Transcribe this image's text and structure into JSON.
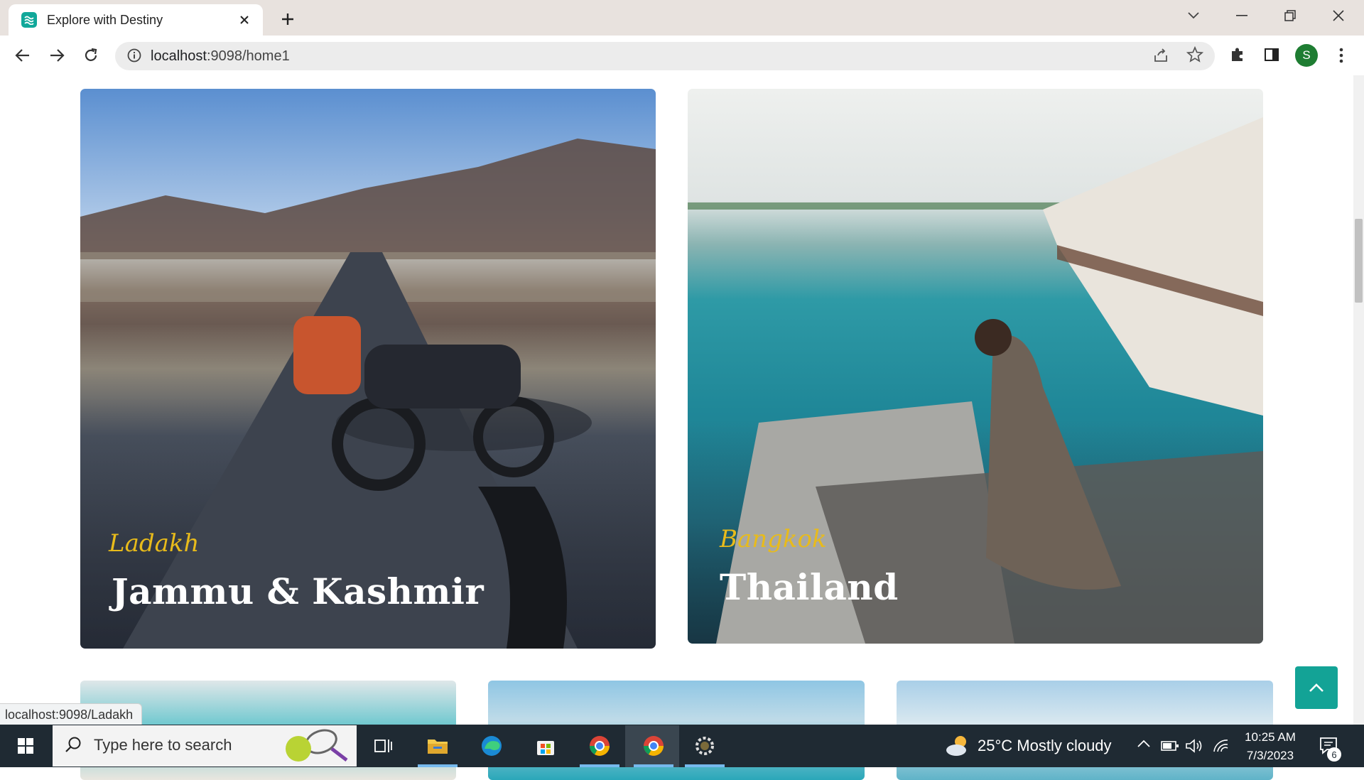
{
  "browser": {
    "tab_title": "Explore with Destiny",
    "url_host": "localhost",
    "url_path": ":9098/home1",
    "profile_initial": "S"
  },
  "page": {
    "cards": [
      {
        "subtitle": "Ladakh",
        "destination": "Jammu & Kashmir"
      },
      {
        "subtitle": "Bangkok",
        "destination": "Thailand"
      }
    ],
    "status_url": "localhost:9098/Ladakh"
  },
  "taskbar": {
    "search_placeholder": "Type here to search",
    "weather": "25°C  Mostly cloudy",
    "time": "10:25 AM",
    "date": "7/3/2023",
    "notification_count": "6"
  },
  "colors": {
    "accent": "#13a396",
    "subtitle": "#e8bb1b"
  }
}
